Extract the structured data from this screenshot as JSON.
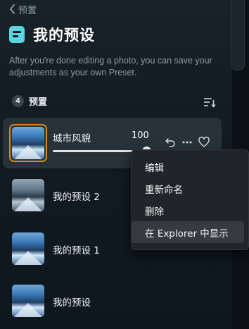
{
  "nav": {
    "back_label": "预置"
  },
  "header": {
    "title": "我的预设",
    "description": "After you're done editing a photo, you can save your adjustments as your own Preset."
  },
  "section": {
    "count": "4",
    "label": "预置"
  },
  "presets": [
    {
      "name": "城市风貌",
      "amount": "100",
      "amount_fraction": 1.0,
      "selected": true
    },
    {
      "name": "我的预设 2",
      "selected": false
    },
    {
      "name": "我的预设 1",
      "selected": false
    },
    {
      "name": "我的预设",
      "selected": false
    }
  ],
  "context_menu": {
    "items": [
      {
        "label": "编辑"
      },
      {
        "label": "重新命名"
      },
      {
        "label": "删除"
      },
      {
        "label": "在 Explorer 中显示",
        "highlighted": true
      }
    ]
  },
  "colors": {
    "accent_icon": "#5ad6e2",
    "selected_frame": "#d28a1f",
    "panel_bg": "#121b22",
    "menu_bg": "#1f2529"
  },
  "icons": {
    "back": "chevron-left-icon",
    "title": "preset-icon",
    "sort": "sort-icon",
    "reset": "undo-icon",
    "more": "more-horizontal-icon",
    "favorite": "heart-icon"
  }
}
